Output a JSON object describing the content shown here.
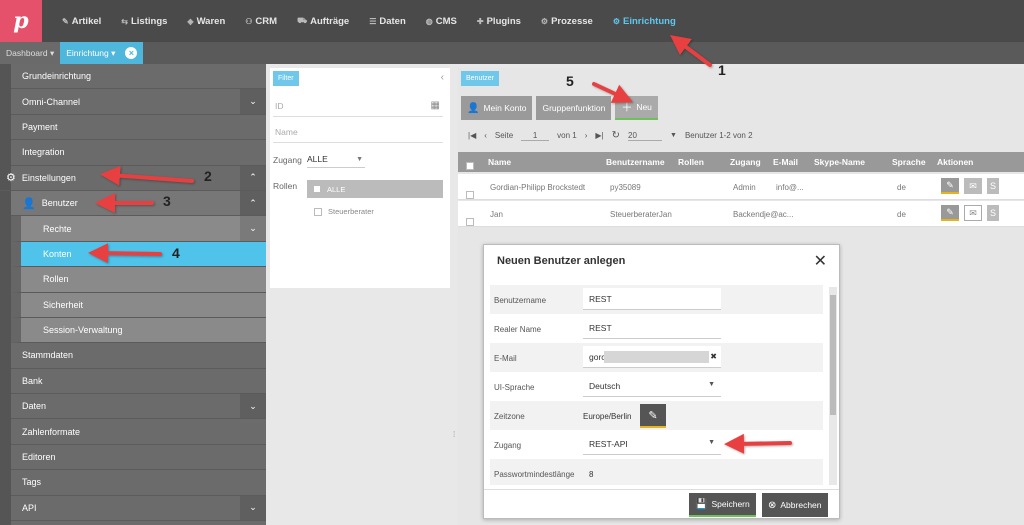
{
  "nav": {
    "logo": "p",
    "items": [
      {
        "icon": "tag-icon",
        "glyph": "✎",
        "label": "Artikel"
      },
      {
        "icon": "listing-icon",
        "glyph": "⇆",
        "label": "Listings"
      },
      {
        "icon": "goods-icon",
        "glyph": "◈",
        "label": "Waren"
      },
      {
        "icon": "people-icon",
        "glyph": "⚇",
        "label": "CRM"
      },
      {
        "icon": "cart-icon",
        "glyph": "⛟",
        "label": "Aufträge"
      },
      {
        "icon": "database-icon",
        "glyph": "☰",
        "label": "Daten"
      },
      {
        "icon": "globe-icon",
        "glyph": "◍",
        "label": "CMS"
      },
      {
        "icon": "puzzle-icon",
        "glyph": "✚",
        "label": "Plugins"
      },
      {
        "icon": "process-icon",
        "glyph": "⚙",
        "label": "Prozesse"
      },
      {
        "icon": "gear-icon",
        "glyph": "⚙",
        "label": "Einrichtung"
      }
    ],
    "active_color": "#5ec8ee"
  },
  "tabs": {
    "dashboard": "Dashboard ▾",
    "active": "Einrichtung ▾"
  },
  "sidebar": {
    "items": [
      {
        "label": "Grundeinrichtung",
        "chevron": ""
      },
      {
        "label": "Omni-Channel",
        "chevron": "⌄"
      },
      {
        "label": "Payment",
        "chevron": ""
      },
      {
        "label": "Integration",
        "chevron": ""
      },
      {
        "label": "Einstellungen",
        "chevron": "⌃"
      },
      {
        "label": "Benutzer",
        "chevron": "⌃"
      },
      {
        "label": "Rechte",
        "chevron": "⌄"
      },
      {
        "label": "Konten",
        "chevron": ""
      },
      {
        "label": "Rollen",
        "chevron": ""
      },
      {
        "label": "Sicherheit",
        "chevron": ""
      },
      {
        "label": "Session-Verwaltung",
        "chevron": ""
      },
      {
        "label": "Stammdaten",
        "chevron": ""
      },
      {
        "label": "Bank",
        "chevron": ""
      },
      {
        "label": "Daten",
        "chevron": "⌄"
      },
      {
        "label": "Zahlenformate",
        "chevron": ""
      },
      {
        "label": "Editoren",
        "chevron": ""
      },
      {
        "label": "Tags",
        "chevron": ""
      },
      {
        "label": "API",
        "chevron": "⌄"
      }
    ]
  },
  "filter": {
    "tag": "Filter",
    "id_placeholder": "ID",
    "name_placeholder": "Name",
    "zugang_label": "Zugang",
    "zugang_value": "ALLE",
    "rollen_label": "Rollen",
    "rollen_all": "ALLE",
    "rollen_item": "Steuerberater"
  },
  "main": {
    "tag": "Benutzer",
    "buttons": {
      "mein_konto": "Mein Konto",
      "gruppenfunktion": "Gruppenfunktion",
      "neu": "Neu"
    },
    "pager": {
      "seite": "Seite",
      "page": "1",
      "von": "von 1",
      "per_page": "20",
      "range": "Benutzer 1-2 von 2"
    },
    "columns": [
      "Name",
      "Benutzername",
      "Rollen",
      "Zugang",
      "E-Mail",
      "Skype-Name",
      "Sprache",
      "Aktionen"
    ],
    "rows": [
      {
        "name": "Gordian-Philipp Brockstedt",
        "benutzername": "py35089",
        "rollen": "",
        "zugang": "Admin",
        "email": "info@...",
        "skype": "",
        "sprache": "de"
      },
      {
        "name": "Jan",
        "benutzername": "SteuerberaterJan",
        "rollen": "",
        "zugang": "Backend",
        "email": "je@ac...",
        "skype": "",
        "sprache": "de"
      }
    ]
  },
  "modal": {
    "title": "Neuen Benutzer anlegen",
    "fields": [
      {
        "label": "Benutzername",
        "value": "REST",
        "type": "text"
      },
      {
        "label": "Realer Name",
        "value": "REST",
        "type": "text"
      },
      {
        "label": "E-Mail",
        "value": "gorc",
        "type": "text"
      },
      {
        "label": "UI-Sprache",
        "value": "Deutsch",
        "type": "select"
      },
      {
        "label": "Zeitzone",
        "value": "Europe/Berlin",
        "type": "edit"
      },
      {
        "label": "Zugang",
        "value": "REST-API",
        "type": "select"
      },
      {
        "label": "Passwortmindestlänge",
        "value": "8",
        "type": "static"
      }
    ],
    "save": "Speichern",
    "cancel": "Abbrechen"
  },
  "annotations": {
    "color": "#e84040",
    "labels": [
      "1",
      "2",
      "3",
      "4",
      "5"
    ]
  }
}
